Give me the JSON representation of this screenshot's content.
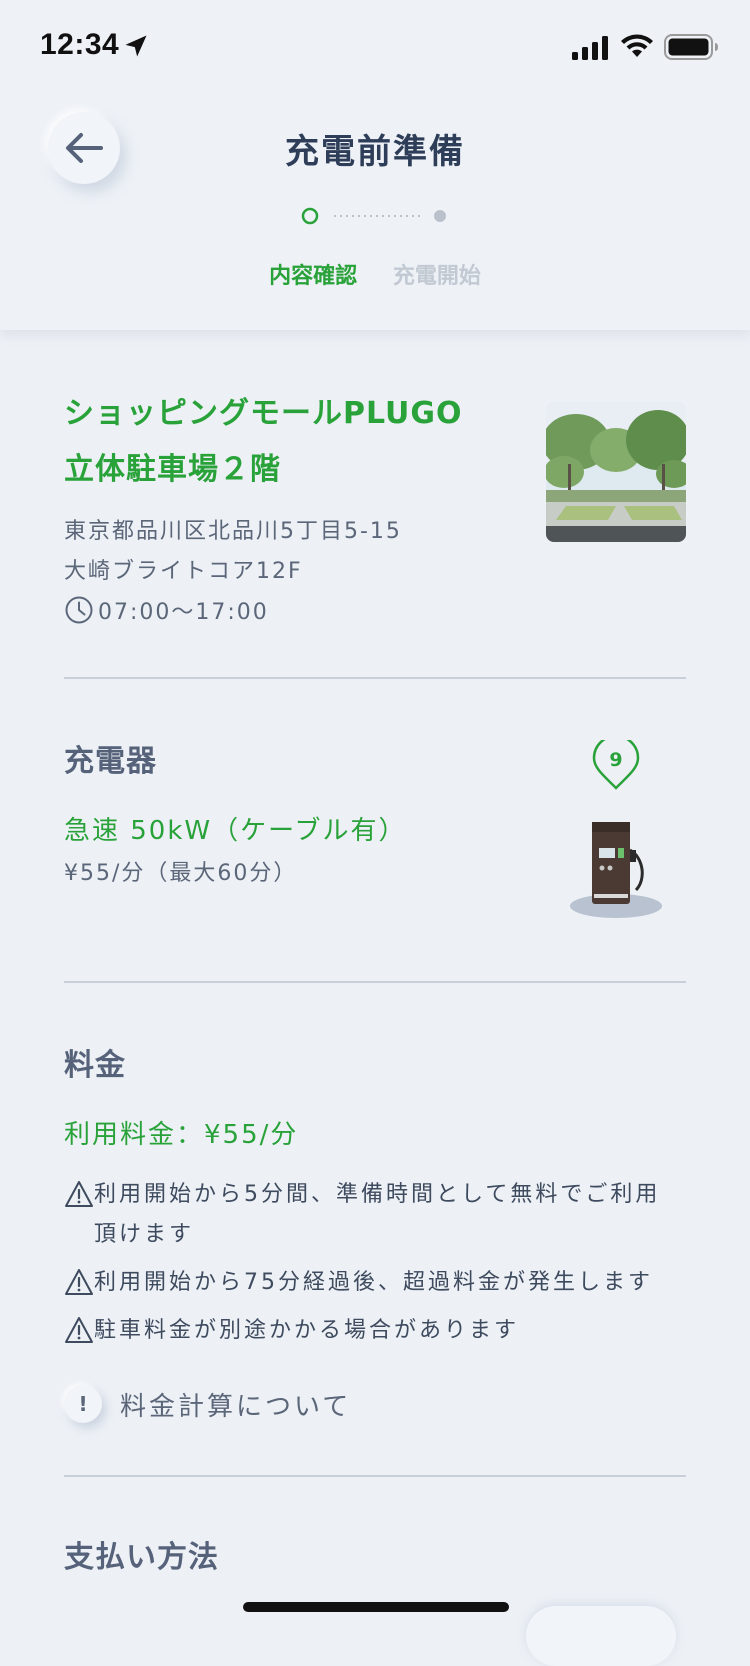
{
  "status_bar": {
    "time": "12:34"
  },
  "header": {
    "title": "充電前準備",
    "steps": [
      {
        "label": "内容確認",
        "active": true
      },
      {
        "label": "充電開始",
        "active": false
      }
    ]
  },
  "station": {
    "name_line1": "ショッピングモールPLUGO",
    "name_line2": "立体駐車場２階",
    "address_line1": "東京都品川区北品川5丁目5-15",
    "address_line2": "大崎ブライトコア12F",
    "hours": "07:00～17:00"
  },
  "charger": {
    "section_title": "充電器",
    "type": "急速 50kW（ケーブル有）",
    "price": "¥55/分（最大60分）",
    "number": "9"
  },
  "fee": {
    "section_title": "料金",
    "main": "利用料金：¥55/分",
    "notices": [
      "利用開始から5分間、準備時間として無料でご利用頂けます",
      "利用開始から75分経過後、超過料金が発生します",
      "駐車料金が別途かかる場合があります"
    ],
    "info_icon": "!",
    "info_label": "料金計算について"
  },
  "payment": {
    "section_title": "支払い方法"
  },
  "colors": {
    "accent": "#2aa23a",
    "background": "#edf1f6",
    "title": "#2e3d58",
    "text": "#56627a"
  }
}
